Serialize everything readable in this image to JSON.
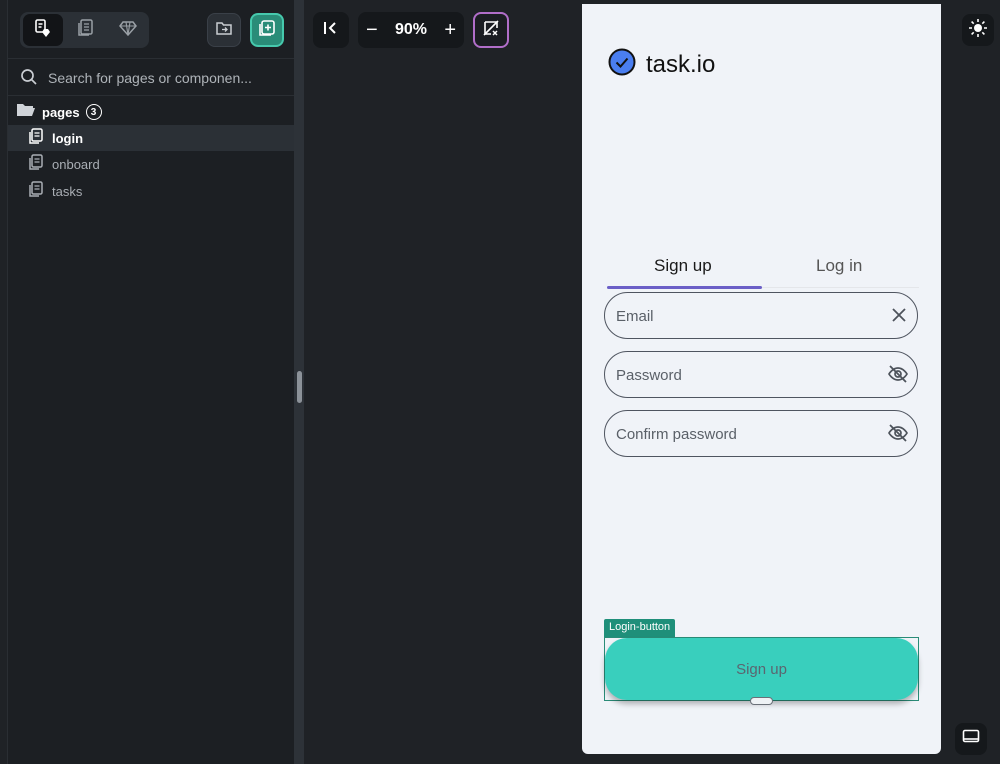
{
  "left_panel": {
    "toolbar": {
      "tabs": [
        {
          "icon": "page-component-icon"
        },
        {
          "icon": "pages-icon"
        },
        {
          "icon": "diamond-icon"
        }
      ],
      "folder_icon": "folder-add-icon",
      "add_page_icon": "add-page-icon"
    },
    "search": {
      "placeholder": "Search for pages or componen..."
    },
    "pages_section": {
      "label": "pages",
      "count": "3",
      "items": [
        {
          "label": "login",
          "selected": true
        },
        {
          "label": "onboard",
          "selected": false
        },
        {
          "label": "tasks",
          "selected": false
        }
      ]
    }
  },
  "canvas_toolbar": {
    "zoom": "90%",
    "zoom_out": "−",
    "zoom_in": "+"
  },
  "phone": {
    "brand": "task.io",
    "tabs": {
      "signup": "Sign up",
      "login": "Log in"
    },
    "fields": {
      "email_placeholder": "Email",
      "password_placeholder": "Password",
      "confirm_placeholder": "Confirm password"
    },
    "selection_tag": "Login-button",
    "signup_button": "Sign up"
  },
  "colors": {
    "accent_teal": "#39cfbd",
    "tab_underline": "#6b5fc7",
    "panel_bg": "#1c1f23",
    "canvas_bg": "#1f2226"
  }
}
